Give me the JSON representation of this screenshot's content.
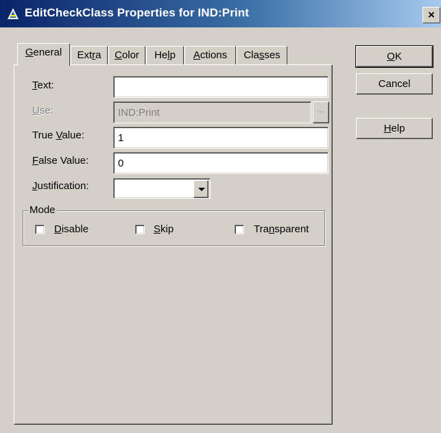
{
  "window": {
    "title": "EditCheckClass Properties for IND:Print",
    "close_symbol": "×",
    "icon": "clarion-a-icon"
  },
  "tabs": [
    {
      "label": "General",
      "mnemonic": "G",
      "active": true
    },
    {
      "label": "Extra",
      "mnemonic": "r",
      "active": false
    },
    {
      "label": "Color",
      "mnemonic": "C",
      "active": false
    },
    {
      "label": "Help",
      "mnemonic": "l",
      "active": false
    },
    {
      "label": "Actions",
      "mnemonic": "A",
      "active": false
    },
    {
      "label": "Classes",
      "mnemonic": "s",
      "active": false
    }
  ],
  "fields": {
    "text": {
      "label": "Text:",
      "value": ""
    },
    "use": {
      "label": "Use:",
      "value": "IND:Print",
      "disabled": true,
      "button": "..."
    },
    "true_value": {
      "label": "True Value:",
      "value": "1"
    },
    "false_value": {
      "label": "False Value:",
      "value": "0"
    },
    "justification": {
      "label": "Justification:",
      "value": ""
    }
  },
  "mode": {
    "label": "Mode",
    "options": [
      {
        "label": "Disable",
        "checked": false
      },
      {
        "label": "Skip",
        "checked": false
      },
      {
        "label": "Transparent",
        "checked": false
      }
    ]
  },
  "buttons": {
    "ok": "OK",
    "cancel": "Cancel",
    "help": "Help"
  },
  "colors": {
    "title_start": "#0a246a",
    "title_end": "#a6caf0",
    "face": "#d4d0c8"
  }
}
